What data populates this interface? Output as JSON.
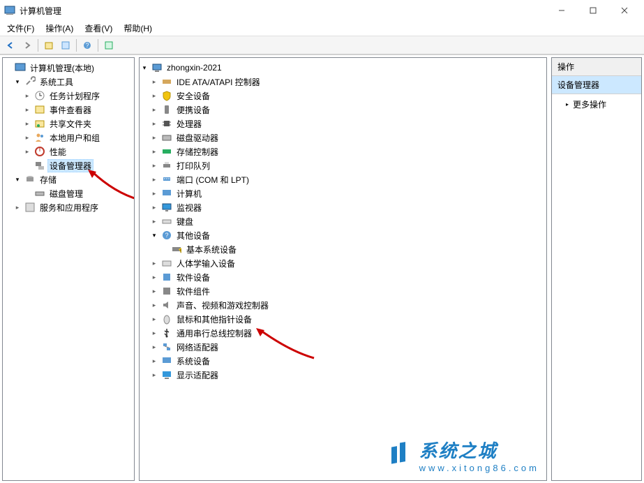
{
  "window": {
    "title": "计算机管理"
  },
  "menu": {
    "file": "文件(F)",
    "action": "操作(A)",
    "view": "查看(V)",
    "help": "帮助(H)"
  },
  "left_tree": {
    "root": "计算机管理(本地)",
    "system_tools": "系统工具",
    "task_scheduler": "任务计划程序",
    "event_viewer": "事件查看器",
    "shared_folders": "共享文件夹",
    "local_users": "本地用户和组",
    "performance": "性能",
    "device_manager": "设备管理器",
    "storage": "存储",
    "disk_management": "磁盘管理",
    "services_apps": "服务和应用程序"
  },
  "center_tree": {
    "root": "zhongxin-2021",
    "ide": "IDE ATA/ATAPI 控制器",
    "security": "安全设备",
    "portable": "便携设备",
    "processors": "处理器",
    "disk_drives": "磁盘驱动器",
    "storage_ctrl": "存储控制器",
    "print_queues": "打印队列",
    "ports": "端口 (COM 和 LPT)",
    "computer": "计算机",
    "monitors": "监视器",
    "keyboards": "键盘",
    "other_devices": "其他设备",
    "base_system": "基本系统设备",
    "hid": "人体学输入设备",
    "software_dev": "软件设备",
    "software_comp": "软件组件",
    "sound": "声音、视频和游戏控制器",
    "mouse": "鼠标和其他指针设备",
    "usb": "通用串行总线控制器",
    "network": "网络适配器",
    "system_dev": "系统设备",
    "display": "显示适配器"
  },
  "right": {
    "header": "操作",
    "selected": "设备管理器",
    "more": "更多操作"
  },
  "watermark": {
    "name": "系统之城",
    "url": "www.xitong86.com"
  }
}
